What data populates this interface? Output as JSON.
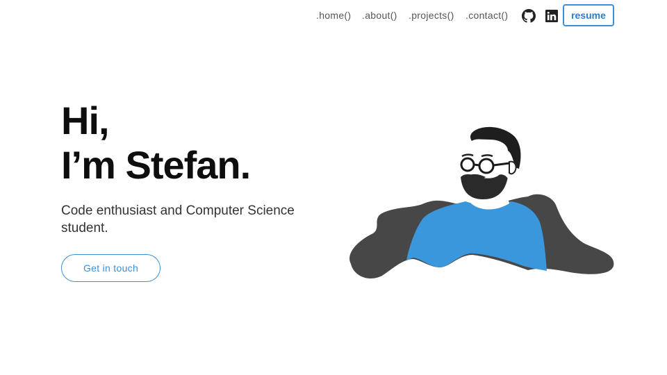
{
  "nav": {
    "links": [
      ".home()",
      ".about()",
      ".projects()",
      ".contact()"
    ],
    "github_icon": "github-icon",
    "linkedin_icon": "linkedin-icon",
    "resume_label": "resume"
  },
  "hero": {
    "greeting": "Hi,",
    "name_line": "I’m Stefan.",
    "subtitle": "Code enthusiast and Computer Science student.",
    "cta_label": "Get in touch"
  },
  "colors": {
    "accent": "#3a8fd6",
    "shirt": "#3a97db",
    "blob": "#474747",
    "text": "#111111"
  }
}
